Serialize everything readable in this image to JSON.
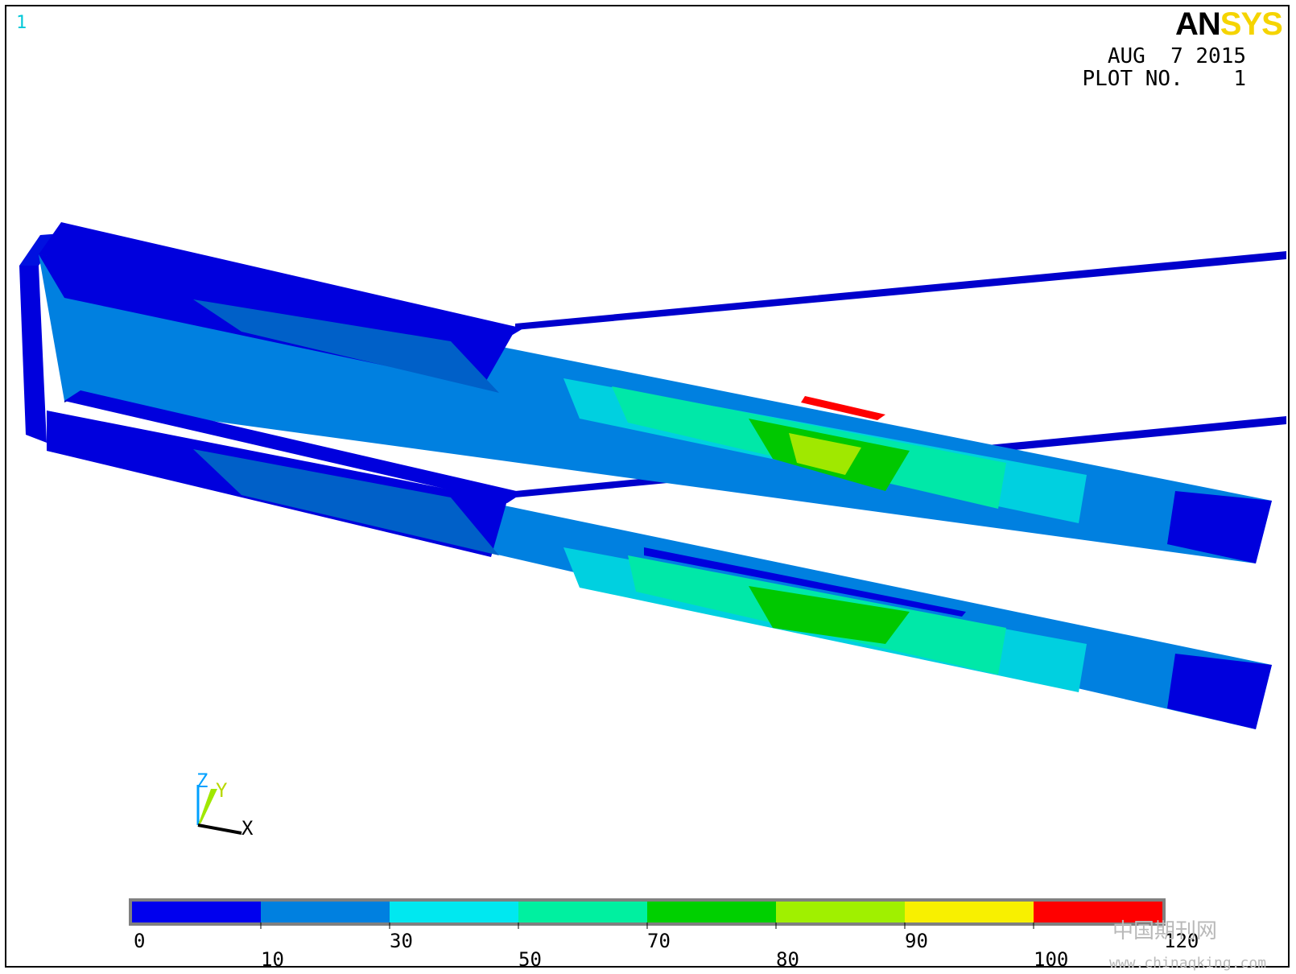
{
  "window_number": "1",
  "logo": {
    "left": "AN",
    "right": "SYS"
  },
  "date_text": "AUG  7 2015",
  "plot_text": "PLOT NO.    1",
  "triad": {
    "z": "Z",
    "y": "Y",
    "x": "X"
  },
  "legend": {
    "colors": [
      "#0000ee",
      "#0080e0",
      "#00e8f0",
      "#00f0a0",
      "#00d000",
      "#a0f000",
      "#f8f000",
      "#ff0000"
    ],
    "top_labels": [
      "0",
      "30",
      "70",
      "90",
      "120"
    ],
    "bottom_labels": [
      "10",
      "50",
      "80",
      "100"
    ]
  },
  "watermark": {
    "cn": "中国期刊网",
    "url": "www.chinaqking.com"
  }
}
